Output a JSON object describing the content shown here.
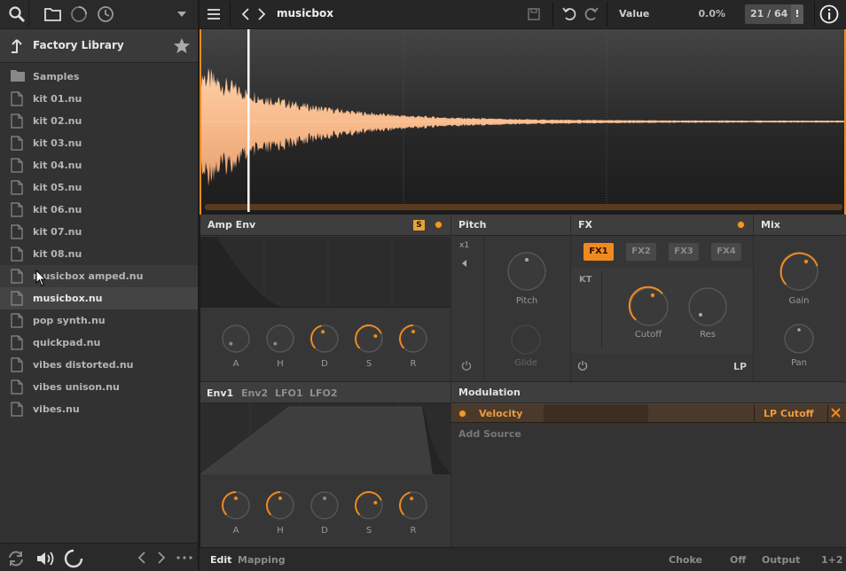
{
  "toolbar": {
    "preset_name": "musicbox",
    "value_label": "Value",
    "value_amount": "0.0%",
    "counter": "21 / 64",
    "counter_alert": "!"
  },
  "browser": {
    "library_title": "Factory Library",
    "files": [
      {
        "name": "Samples",
        "kind": "folder"
      },
      {
        "name": "kit 01.nu",
        "kind": "file"
      },
      {
        "name": "kit 02.nu",
        "kind": "file"
      },
      {
        "name": "kit 03.nu",
        "kind": "file"
      },
      {
        "name": "kit 04.nu",
        "kind": "file"
      },
      {
        "name": "kit 05.nu",
        "kind": "file"
      },
      {
        "name": "kit 06.nu",
        "kind": "file"
      },
      {
        "name": "kit 07.nu",
        "kind": "file"
      },
      {
        "name": "kit 08.nu",
        "kind": "file"
      },
      {
        "name": "musicbox amped.nu",
        "kind": "file",
        "hover": true
      },
      {
        "name": "musicbox.nu",
        "kind": "file",
        "selected": true
      },
      {
        "name": "pop synth.nu",
        "kind": "file"
      },
      {
        "name": "quickpad.nu",
        "kind": "file"
      },
      {
        "name": "vibes distorted.nu",
        "kind": "file"
      },
      {
        "name": "vibes unison.nu",
        "kind": "file"
      },
      {
        "name": "vibes.nu",
        "kind": "file"
      }
    ]
  },
  "amp_env": {
    "title": "Amp Env",
    "solo_badge": "S",
    "knobs": [
      {
        "label": "A",
        "level": 0.0,
        "active": false
      },
      {
        "label": "H",
        "level": 0.0,
        "active": false
      },
      {
        "label": "D",
        "level": 0.45,
        "active": true
      },
      {
        "label": "S",
        "level": 0.75,
        "active": true
      },
      {
        "label": "R",
        "level": 0.5,
        "active": true
      }
    ]
  },
  "pitch": {
    "title": "Pitch",
    "multiplier": "x1",
    "pitch_label": "Pitch",
    "glide_label": "Glide"
  },
  "fx": {
    "title": "FX",
    "slots": [
      "FX1",
      "FX2",
      "FX3",
      "FX4"
    ],
    "active_slot": 0,
    "kt_label": "KT",
    "cutoff_label": "Cutoff",
    "res_label": "Res",
    "filter_type": "LP"
  },
  "mix": {
    "title": "Mix",
    "gain_label": "Gain",
    "pan_label": "Pan"
  },
  "mod_env": {
    "tabs": [
      "Env1",
      "Env2",
      "LFO1",
      "LFO2"
    ],
    "active_tab": 0,
    "knobs": [
      {
        "label": "A",
        "level": 0.5,
        "active": true
      },
      {
        "label": "H",
        "level": 0.5,
        "active": true
      },
      {
        "label": "D",
        "level": 0.5,
        "active": false
      },
      {
        "label": "S",
        "level": 0.75,
        "active": true
      },
      {
        "label": "R",
        "level": 0.45,
        "active": true
      }
    ]
  },
  "modulation": {
    "title": "Modulation",
    "source": "Velocity",
    "target": "LP Cutoff",
    "add_source": "Add Source"
  },
  "bottom": {
    "edit": "Edit",
    "mapping": "Mapping",
    "choke_label": "Choke",
    "choke_value": "Off",
    "output_label": "Output",
    "output_value": "1+2"
  },
  "icons": {
    "search": "search-icon",
    "folder": "folder-icon",
    "history": "clock-icon",
    "refresh": "refresh-icon"
  },
  "colors": {
    "accent": "#f08a1e",
    "waveform": "#f7b98a",
    "playhead": "#ffffff"
  }
}
